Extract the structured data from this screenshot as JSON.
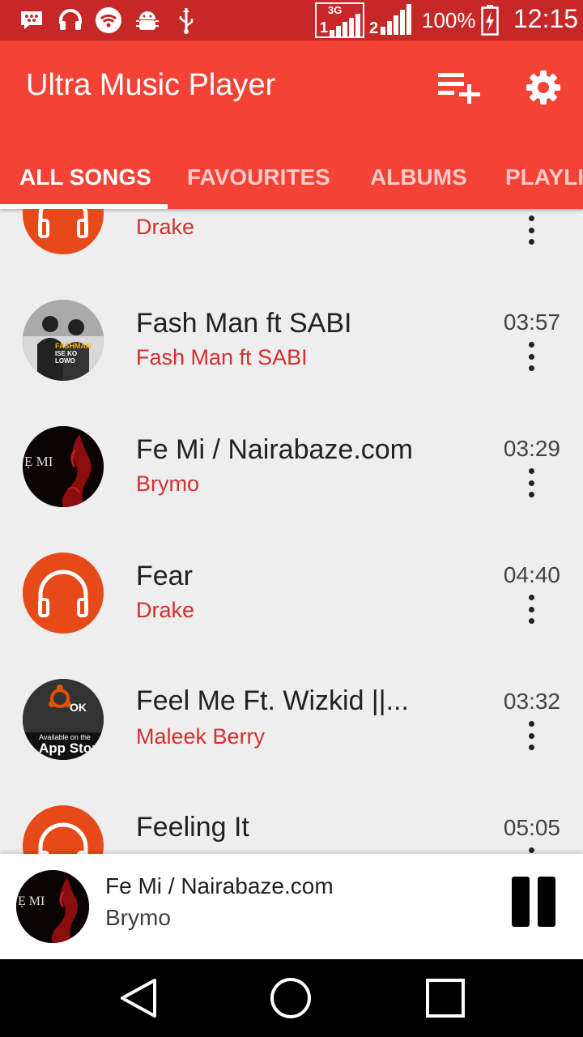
{
  "status_bar": {
    "icons": [
      "bbm-icon",
      "headset-icon",
      "wifi-icon",
      "android-debug-icon",
      "usb-icon"
    ],
    "sim1_network": "3G",
    "sim1_label": "1",
    "sim2_label": "2",
    "battery_percent": "100%",
    "time": "12:15"
  },
  "app_bar": {
    "title": "Ultra Music Player",
    "actions": [
      "playlist-add-icon",
      "settings-icon"
    ]
  },
  "tabs": [
    {
      "label": "ALL SONGS",
      "active": true
    },
    {
      "label": "FAVOURITES",
      "active": false
    },
    {
      "label": "ALBUMS",
      "active": false
    },
    {
      "label": "PLAYLI",
      "active": false
    }
  ],
  "songs": [
    {
      "title": "",
      "artist": "Drake",
      "duration": "",
      "art": "default-headphones"
    },
    {
      "title": "Fash Man ft SABI",
      "artist": "Fash Man ft SABI",
      "duration": "03:57",
      "art": "fashman-cover",
      "art_text": [
        "FASHMAN",
        "ISE KO",
        "LOWO"
      ]
    },
    {
      "title": "Fe Mi / Nairabaze.com",
      "artist": "Brymo",
      "duration": "03:29",
      "art": "femi-cover",
      "art_text": "Ẹ MI"
    },
    {
      "title": "Fear",
      "artist": "Drake",
      "duration": "04:40",
      "art": "default-headphones"
    },
    {
      "title": "Feel Me Ft. Wizkid ||...",
      "artist": "Maleek Berry",
      "duration": "03:32",
      "art": "appstore-cover",
      "art_text": [
        "Available on the",
        "App Store"
      ]
    },
    {
      "title": "Feeling It",
      "artist": "",
      "duration": "05:05",
      "art": "default-headphones"
    }
  ],
  "now_playing": {
    "title": "Fe Mi / Nairabaze.com",
    "artist": "Brymo",
    "art_text": "Ẹ MI",
    "state": "playing"
  },
  "colors": {
    "status_bar": "#c62828",
    "primary": "#f44336",
    "accent": "#d32f2f",
    "default_art": "#e64a19"
  },
  "nav_bar": [
    "back-icon",
    "home-icon",
    "recents-icon"
  ]
}
